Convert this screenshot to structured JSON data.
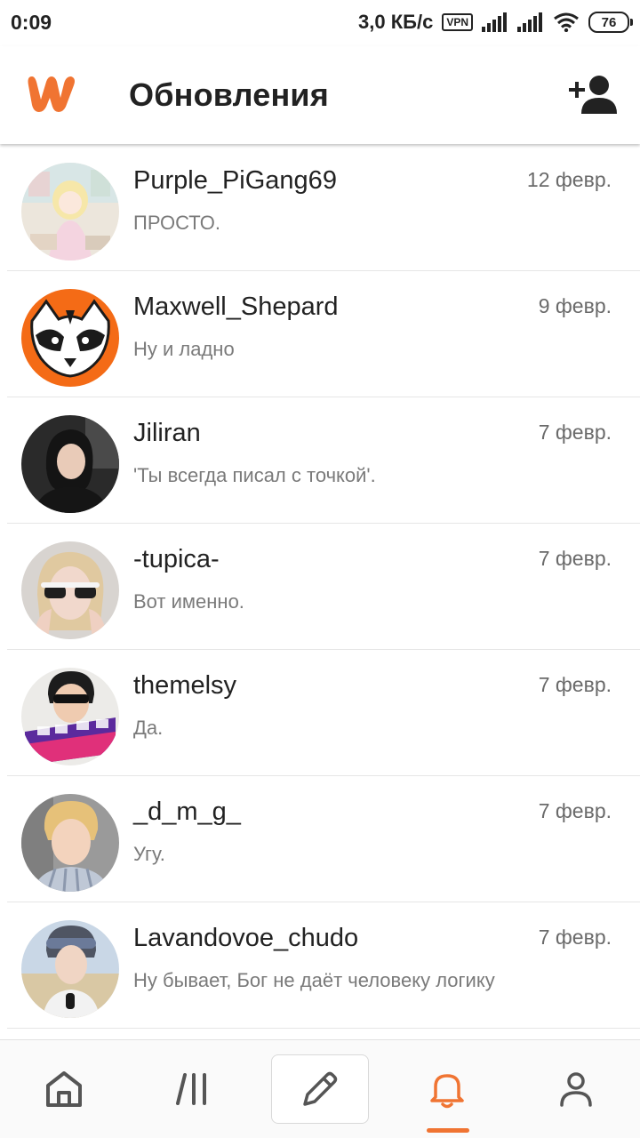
{
  "status_bar": {
    "time": "0:09",
    "speed": "3,0 КБ/с",
    "vpn": "VPN",
    "battery": "76"
  },
  "header": {
    "title": "Обновления",
    "logo_icon": "wattpad-logo-icon",
    "action_icon": "add-user-icon"
  },
  "colors": {
    "accent": "#f07432",
    "text_primary": "#222222",
    "text_secondary": "#7a7a7a"
  },
  "messages": [
    {
      "username": "Purple_PiGang69",
      "preview": "ПРОСТО.",
      "date": "12 февр."
    },
    {
      "username": "Maxwell_Shepard",
      "preview": "Ну и ладно",
      "date": "9 февр."
    },
    {
      "username": "Jiliran",
      "preview": "'Ты всегда писал с точкой'.",
      "date": "7 февр."
    },
    {
      "username": "-tupica-",
      "preview": "Вот именно.",
      "date": "7 февр."
    },
    {
      "username": "themelsy",
      "preview": "Да.",
      "date": "7 февр."
    },
    {
      "username": "_d_m_g_",
      "preview": "Угу.",
      "date": "7 февр."
    },
    {
      "username": "Lavandovoe_chudo",
      "preview": "Ну бывает, Бог не даёт человеку логику",
      "date": "7 февр."
    }
  ],
  "bottom_nav": {
    "items": [
      {
        "icon": "home-icon"
      },
      {
        "icon": "library-icon"
      },
      {
        "icon": "pencil-icon"
      },
      {
        "icon": "bell-icon",
        "active": true
      },
      {
        "icon": "profile-icon"
      }
    ]
  }
}
